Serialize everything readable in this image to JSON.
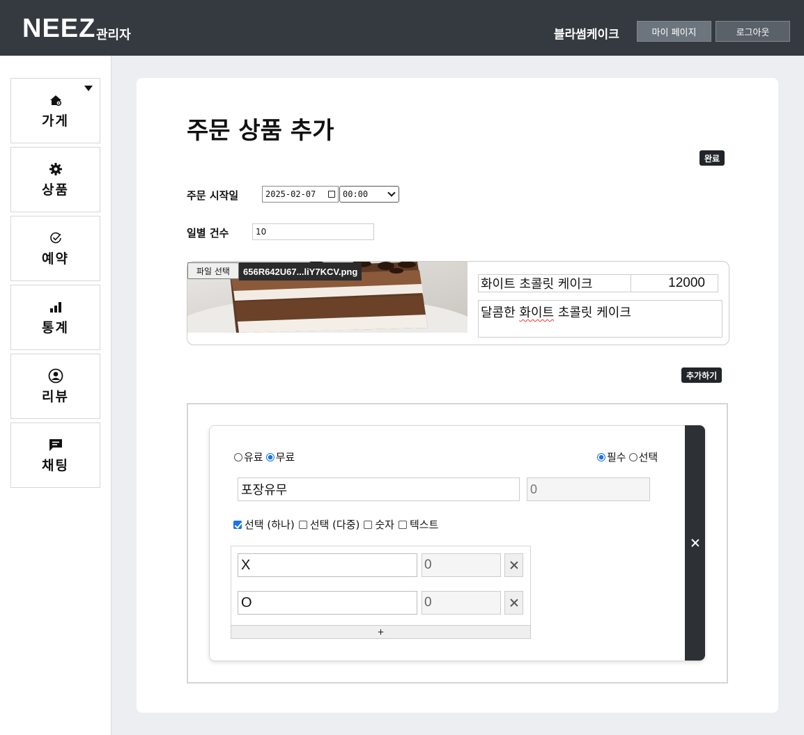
{
  "header": {
    "brand": "NEEZ",
    "brand_sub": "관리자",
    "store_name": "블라썸케이크",
    "mypage_label": "마이 페이지",
    "logout_label": "로그아웃"
  },
  "sidebar": {
    "items": [
      {
        "label": "가게",
        "icon": "store-settings-icon"
      },
      {
        "label": "상품",
        "icon": "gear-icon"
      },
      {
        "label": "예약",
        "icon": "check-circle-icon"
      },
      {
        "label": "통계",
        "icon": "bar-chart-icon"
      },
      {
        "label": "리뷰",
        "icon": "user-circle-icon"
      },
      {
        "label": "채팅",
        "icon": "chat-icon"
      }
    ]
  },
  "page": {
    "title": "주문 상품 추가",
    "done_label": "완료",
    "start_date_label": "주문 시작일",
    "start_date_value": "2025-02-07",
    "start_time_value": "00:00",
    "daily_count_label": "일별 건수",
    "daily_count_value": "10",
    "add_label": "추가하기"
  },
  "product": {
    "file_button": "파일 선택",
    "file_name": "656R642U67...liY7KCV.png",
    "name": "화이트 초콜릿 케이크",
    "price": "12000",
    "desc_prefix": "달콤한 ",
    "desc_misspelled": "화이트",
    "desc_suffix": " 초콜릿 케이크"
  },
  "option": {
    "paid_label": "유료",
    "free_label": "무료",
    "free_selected": true,
    "required_label": "필수",
    "optional_label": "선택",
    "required_selected": true,
    "name": "포장유무",
    "price_placeholder": "0",
    "types": [
      {
        "label": "선택 (하나)",
        "checked": true
      },
      {
        "label": "선택 (다중)",
        "checked": false
      },
      {
        "label": "숫자",
        "checked": false
      },
      {
        "label": "텍스트",
        "checked": false
      }
    ],
    "choices": [
      {
        "name": "X",
        "price": "0"
      },
      {
        "name": "O",
        "price": "0"
      }
    ],
    "add_choice_label": "+"
  },
  "colors": {
    "header_bg": "#343a40",
    "accent": "#1a73e8",
    "dark_button": "#212529"
  }
}
